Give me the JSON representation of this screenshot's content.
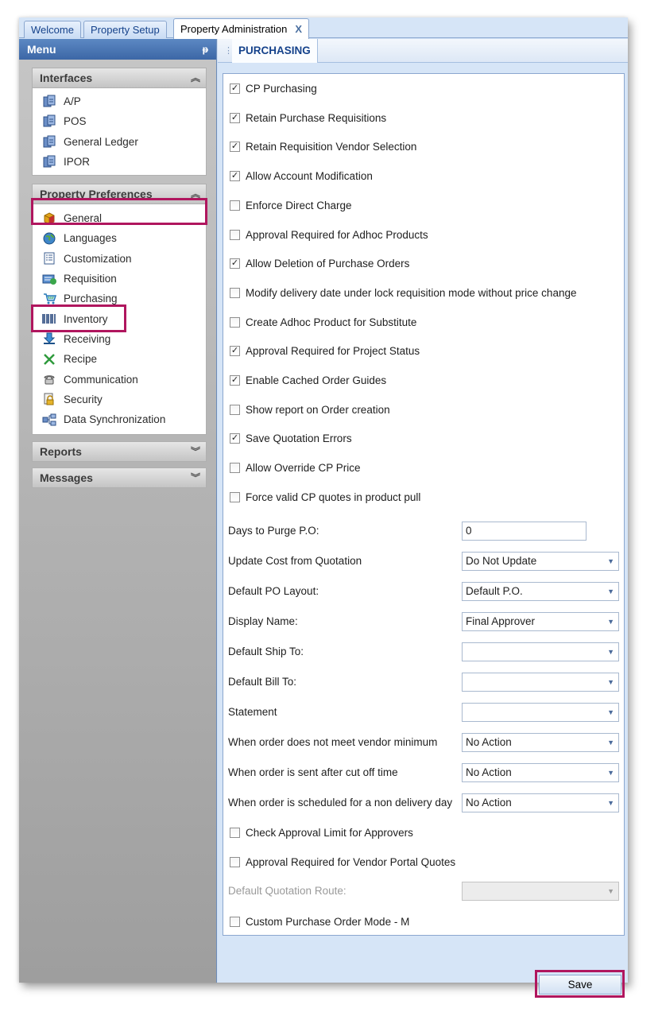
{
  "tabs": [
    {
      "label": "Welcome"
    },
    {
      "label": "Property Setup"
    },
    {
      "label": "Property Administration",
      "close": "X"
    }
  ],
  "menu": {
    "title": "Menu",
    "pin": "ᵽ",
    "groups": {
      "interfaces": {
        "title": "Interfaces",
        "items": [
          {
            "label": "A/P",
            "icon": "interface-icon"
          },
          {
            "label": "POS",
            "icon": "interface-icon"
          },
          {
            "label": "General Ledger",
            "icon": "interface-icon"
          },
          {
            "label": "IPOR",
            "icon": "interface-icon"
          }
        ]
      },
      "preferences": {
        "title": "Property Preferences",
        "items": [
          {
            "label": "General",
            "icon": "cube-icon"
          },
          {
            "label": "Languages",
            "icon": "globe-icon"
          },
          {
            "label": "Customization",
            "icon": "list-icon"
          },
          {
            "label": "Requisition",
            "icon": "requisition-icon"
          },
          {
            "label": "Purchasing",
            "icon": "cart-icon"
          },
          {
            "label": "Inventory",
            "icon": "barcode-icon"
          },
          {
            "label": "Receiving",
            "icon": "download-icon"
          },
          {
            "label": "Recipe",
            "icon": "utensils-icon"
          },
          {
            "label": "Communication",
            "icon": "phone-icon"
          },
          {
            "label": "Security",
            "icon": "lock-icon"
          },
          {
            "label": "Data Synchronization",
            "icon": "sync-icon"
          }
        ]
      },
      "reports": {
        "title": "Reports"
      },
      "messages": {
        "title": "Messages"
      }
    }
  },
  "section": {
    "title": "PURCHASING"
  },
  "checkboxes_top": [
    {
      "label": "CP Purchasing",
      "checked": true
    },
    {
      "label": "Retain Purchase Requisitions",
      "checked": true
    },
    {
      "label": "Retain Requisition Vendor Selection",
      "checked": true
    },
    {
      "label": "Allow Account Modification",
      "checked": true
    },
    {
      "label": "Enforce Direct Charge",
      "checked": false
    },
    {
      "label": "Approval Required for Adhoc Products",
      "checked": false
    },
    {
      "label": "Allow Deletion of Purchase Orders",
      "checked": true
    },
    {
      "label": "Modify delivery date under lock requisition mode without price change",
      "checked": false
    },
    {
      "label": "Create Adhoc Product for Substitute",
      "checked": false
    },
    {
      "label": "Approval Required for Project Status",
      "checked": true
    },
    {
      "label": "Enable Cached Order Guides",
      "checked": true
    },
    {
      "label": "Show report on Order creation",
      "checked": false
    },
    {
      "label": "Save Quotation Errors",
      "checked": true
    },
    {
      "label": "Allow Override CP Price",
      "checked": false
    },
    {
      "label": "Force valid CP quotes in product pull",
      "checked": false
    }
  ],
  "fields": [
    {
      "label": "Days to Purge P.O:",
      "value": "0",
      "kind": "text"
    },
    {
      "label": "Update Cost from Quotation",
      "value": "Do Not Update",
      "kind": "select"
    },
    {
      "label": "Default PO Layout:",
      "value": "Default P.O.",
      "kind": "select"
    },
    {
      "label": "Display Name:",
      "value": "Final Approver",
      "kind": "select"
    },
    {
      "label": "Default Ship To:",
      "value": "",
      "kind": "select"
    },
    {
      "label": "Default Bill To:",
      "value": "",
      "kind": "select"
    },
    {
      "label": "Statement",
      "value": "",
      "kind": "select"
    },
    {
      "label": "When order does not meet vendor minimum",
      "value": "No Action",
      "kind": "select"
    },
    {
      "label": "When order is sent after cut off time",
      "value": "No Action",
      "kind": "select"
    },
    {
      "label": "When order is scheduled for a non delivery day",
      "value": "No Action",
      "kind": "select"
    }
  ],
  "checkboxes_bottom": [
    {
      "label": "Check Approval Limit for Approvers",
      "checked": false
    },
    {
      "label": "Approval Required for Vendor Portal Quotes",
      "checked": false
    }
  ],
  "disabled_field": {
    "label": "Default Quotation Route:",
    "value": ""
  },
  "checkbox_last": {
    "label": "Custom Purchase Order Mode - M",
    "checked": false
  },
  "save_label": "Save",
  "check_mark": "✓",
  "dropdown_arrow": "▼",
  "colors": {
    "highlight": "#b0165e",
    "accent": "#15428b"
  }
}
